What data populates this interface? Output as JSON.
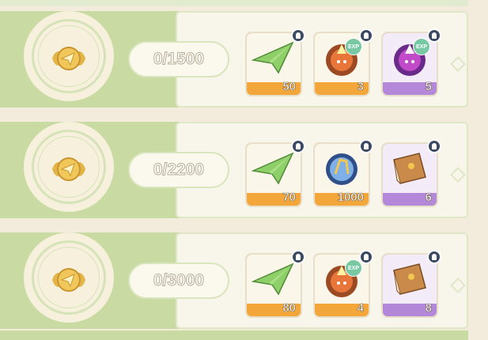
{
  "rows": [
    {
      "progress": "0/1500",
      "rewards": [
        {
          "name": "paper-plane",
          "count": "50",
          "rarity": "orange",
          "exp": false
        },
        {
          "name": "fire-slime-exp",
          "count": "3",
          "rarity": "orange",
          "exp": true
        },
        {
          "name": "purple-slime-exp",
          "count": "5",
          "rarity": "purple",
          "exp": true
        }
      ]
    },
    {
      "progress": "0/2200",
      "rewards": [
        {
          "name": "paper-plane",
          "count": "70",
          "rarity": "orange",
          "exp": false
        },
        {
          "name": "blue-crystal-orb",
          "count": "1000",
          "rarity": "orange",
          "exp": false
        },
        {
          "name": "brown-book",
          "count": "6",
          "rarity": "purple",
          "exp": false
        }
      ]
    },
    {
      "progress": "0/3000",
      "rewards": [
        {
          "name": "paper-plane",
          "count": "80",
          "rarity": "orange",
          "exp": false
        },
        {
          "name": "fire-slime-exp",
          "count": "4",
          "rarity": "orange",
          "exp": true
        },
        {
          "name": "brown-book",
          "count": "8",
          "rarity": "purple",
          "exp": false
        }
      ]
    }
  ],
  "exp_label": "EXP",
  "colors": {
    "row_left": "#c9dba3",
    "row_right": "#f8f5ea",
    "orange_rarity": "#f3a73a",
    "purple_rarity": "#b488d8",
    "badge": "#3b4a62"
  }
}
